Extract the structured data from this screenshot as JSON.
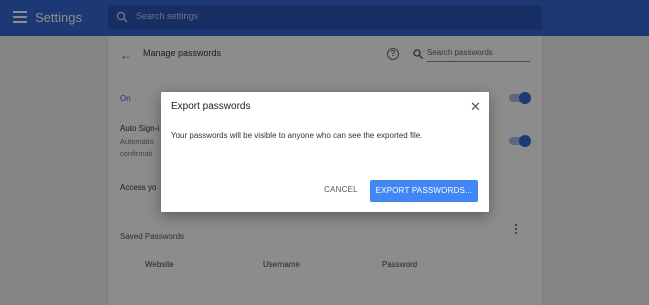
{
  "header": {
    "app_title": "Settings",
    "search_placeholder": "Search settings",
    "menu_icon": "hamburger-menu-icon",
    "search_icon": "search-icon"
  },
  "page": {
    "title": "Manage passwords",
    "back_icon": "back-arrow-icon",
    "help_icon": "help-icon",
    "search_placeholder": "Search passwords",
    "offer_to_save": {
      "label": "On",
      "enabled": true
    },
    "auto_signin": {
      "label": "Auto Sign-i",
      "desc_line1": "Automatio",
      "desc_line2": "confirmati",
      "enabled": true
    },
    "access_label": "Access yo",
    "saved_passwords_label": "Saved Passwords",
    "columns": [
      "Website",
      "Username",
      "Password"
    ]
  },
  "dialog": {
    "title": "Export passwords",
    "body": "Your passwords will be visible to anyone who can see the exported file.",
    "cancel_label": "CANCEL",
    "export_label": "EXPORT PASSWORDS...",
    "close_icon": "close-icon"
  },
  "colors": {
    "header_bg": "#3367d6",
    "accent": "#4285f4"
  }
}
